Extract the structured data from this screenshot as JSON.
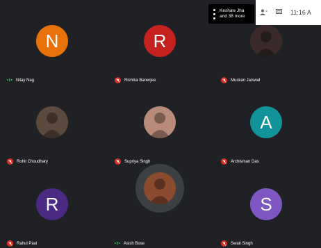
{
  "topbar": {
    "notice_line1": "Keshaw Jha",
    "notice_line2": "and 38 more",
    "time": "11:16 A"
  },
  "participants": [
    {
      "name": "Nilay Nag",
      "initial": "N",
      "color": "#e8710a",
      "audio": "speaking"
    },
    {
      "name": "Rishika Banerjee",
      "initial": "R",
      "color": "#c5221f",
      "audio": "muted"
    },
    {
      "name": "Muskan Jaiswal",
      "initial": "",
      "color": "#3a2a2a",
      "audio": "muted",
      "photo": true
    },
    {
      "name": "Rohit Choudhary",
      "initial": "",
      "color": "#5d4a3f",
      "audio": "muted",
      "photo": true
    },
    {
      "name": "Supriya Singh",
      "initial": "",
      "color": "#b88a7a",
      "audio": "muted",
      "photo": true
    },
    {
      "name": "Archisman Das",
      "initial": "A",
      "color": "#12939a",
      "audio": "muted"
    },
    {
      "name": "Rahul Paul",
      "initial": "R",
      "color": "#4b2a84",
      "audio": "muted"
    },
    {
      "name": "Asish Bose",
      "initial": "",
      "color": "#8a4b2f",
      "audio": "speaking",
      "photo": true
    },
    {
      "name": "Swati Singh",
      "initial": "S",
      "color": "#7e57c2",
      "audio": "muted"
    }
  ]
}
